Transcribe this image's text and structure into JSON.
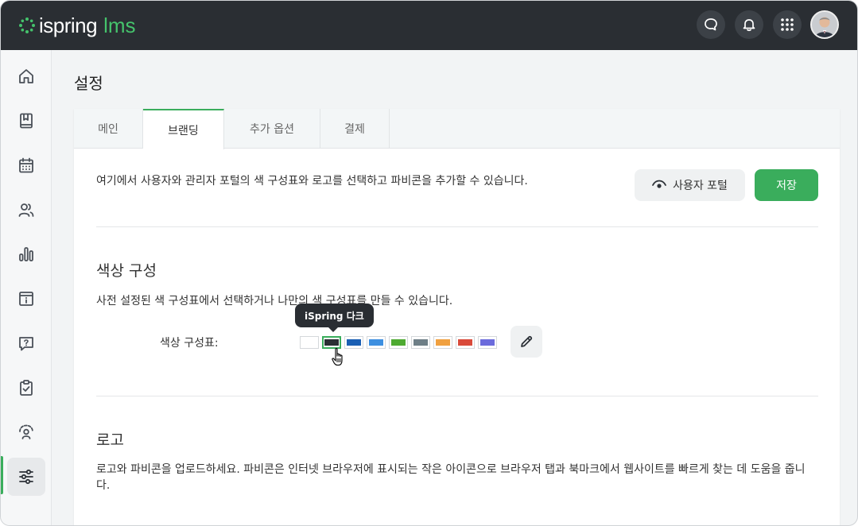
{
  "app": {
    "logo_text": "ispring",
    "logo_suffix": "lms"
  },
  "topbar": {
    "icons": [
      "chat-icon",
      "bell-icon",
      "apps-grid-icon",
      "avatar"
    ]
  },
  "sidebar": {
    "items": [
      {
        "icon": "home-icon"
      },
      {
        "icon": "book-icon"
      },
      {
        "icon": "calendar-icon"
      },
      {
        "icon": "users-icon"
      },
      {
        "icon": "bar-chart-icon"
      },
      {
        "icon": "info-icon"
      },
      {
        "icon": "help-icon"
      },
      {
        "icon": "clipboard-check-icon"
      },
      {
        "icon": "user-feedback-icon"
      },
      {
        "icon": "sliders-icon",
        "active": true
      }
    ]
  },
  "page": {
    "title": "설정"
  },
  "tabs": [
    {
      "label": "메인"
    },
    {
      "label": "브랜딩",
      "active": true
    },
    {
      "label": "추가 옵션"
    },
    {
      "label": "결제"
    }
  ],
  "branding": {
    "intro": "여기에서 사용자와 관리자 포털의 색 구성표와 로고를 선택하고 파비콘을 추가할 수 있습니다.",
    "user_portal_button": "사용자 포털",
    "save_button": "저장",
    "color_section": {
      "title": "색상 구성",
      "description": "사전 설정된 색 구성표에서 선택하거나 나만의 색 구성표를 만들 수 있습니다.",
      "palette_label": "색상 구성표:",
      "tooltip": "iSpring 다크",
      "swatches": [
        "#ffffff",
        "#2a2e33",
        "#1a5fb4",
        "#3d8fe0",
        "#4eaa32",
        "#6e7f87",
        "#f0a040",
        "#d94a3a",
        "#6b6bdc"
      ],
      "selected_index": 1
    },
    "logo_section": {
      "title": "로고",
      "description": "로고와 파비콘을 업로드하세요. 파비콘은 인터넷 브라우저에 표시되는 작은 아이콘으로 브라우저 탭과 북마크에서 웹사이트를 빠르게 찾는 데 도움을 줍니다."
    }
  },
  "colors": {
    "accent": "#3aad5c",
    "topbar": "#2a2e33"
  }
}
